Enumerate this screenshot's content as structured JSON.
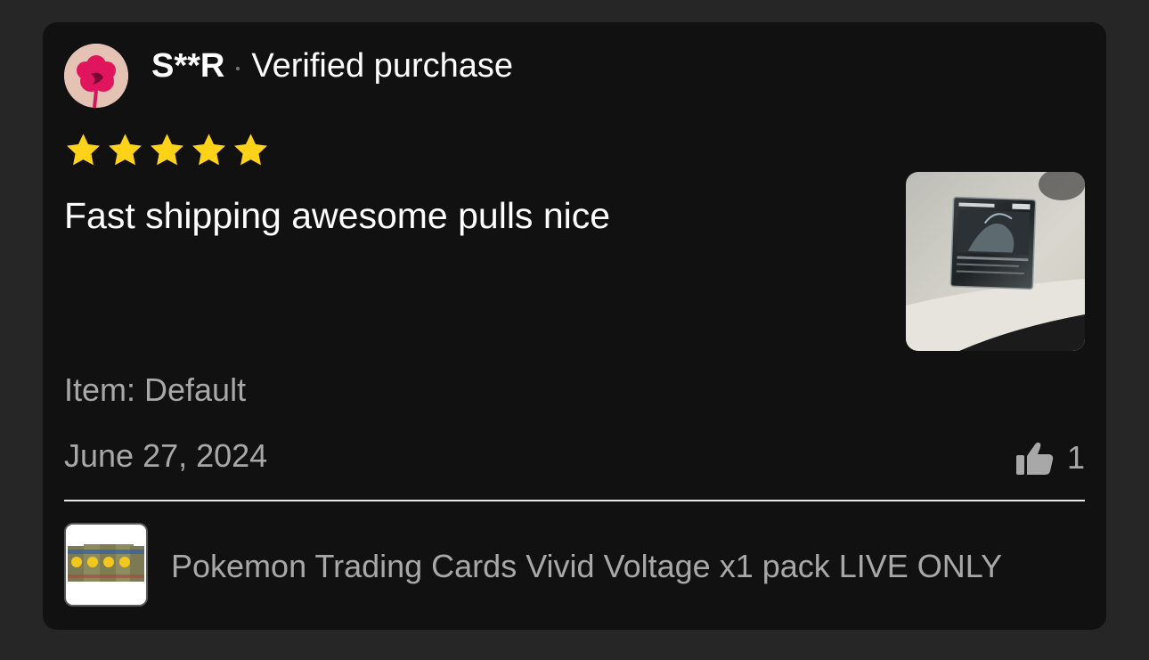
{
  "reviewer": {
    "username": "S**R",
    "badge": "Verified purchase",
    "avatar_icon": "flower-avatar-icon"
  },
  "review": {
    "rating": 5,
    "max_rating": 5,
    "text": "Fast shipping awesome pulls nice",
    "item_label": "Item: Default",
    "date": "June 27, 2024",
    "likes": "1"
  },
  "product": {
    "title": "Pokemon Trading Cards Vivid Voltage x1 pack LIVE ONLY"
  },
  "colors": {
    "background": "#262626",
    "card": "#111111",
    "star": "#ffd21a",
    "secondary_text": "#a8a8a8"
  }
}
